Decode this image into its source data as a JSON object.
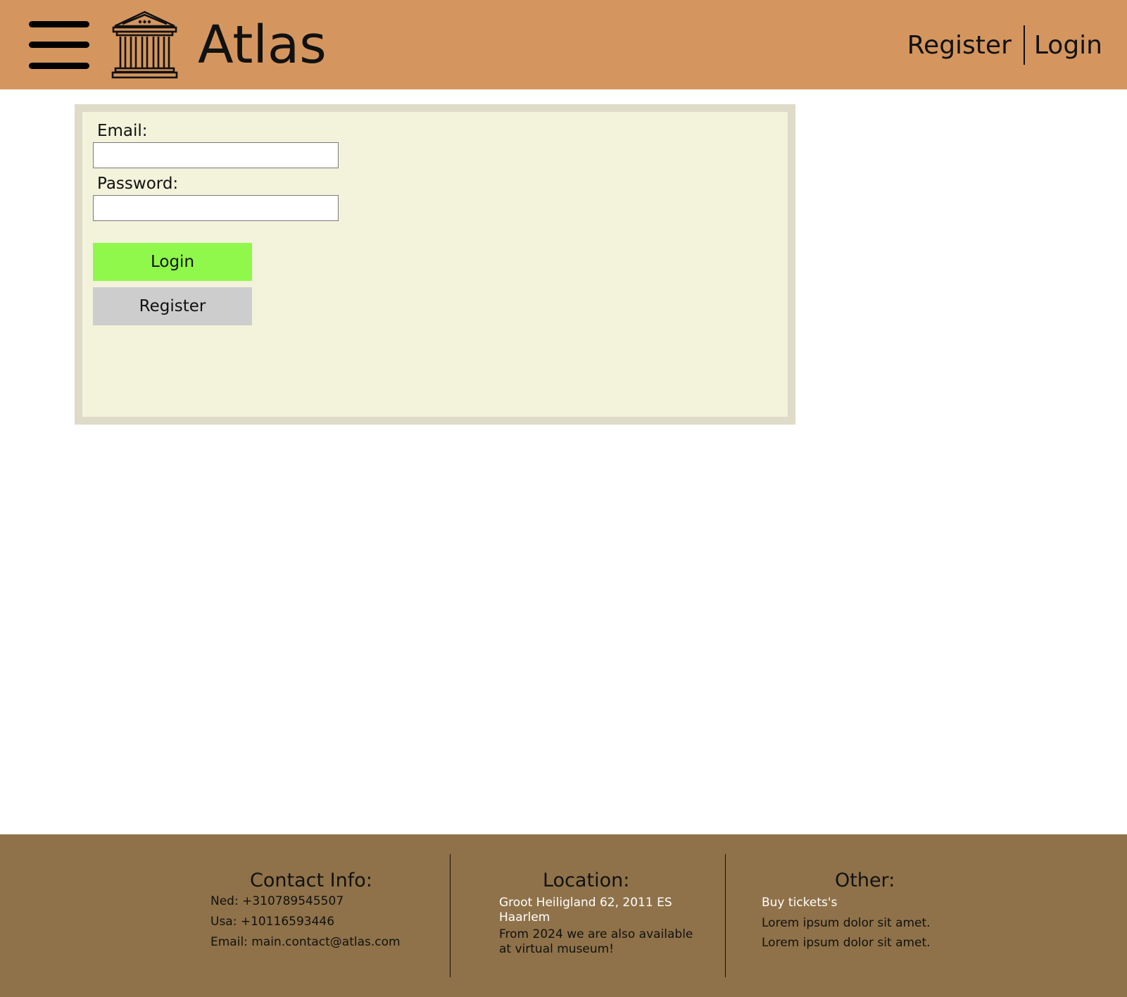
{
  "header": {
    "brand": "Atlas",
    "nav": {
      "register_label": "Register",
      "login_label": "Login"
    },
    "icons": [
      "menu-icon",
      "museum-icon"
    ]
  },
  "login_form": {
    "email_label": "Email:",
    "email_value": "",
    "password_label": "Password:",
    "password_value": "",
    "login_button": "Login",
    "register_button": "Register"
  },
  "footer": {
    "contact": {
      "heading": "Contact Info:",
      "lines": [
        "Ned: +310789545507",
        "Usa: +10116593446",
        "Email: main.contact@atlas.com"
      ]
    },
    "location": {
      "heading": "Location:",
      "address": "Groot Heiligland 62, 2011 ES Haarlem",
      "note": "From 2024 we are also available at virtual museum!"
    },
    "other": {
      "heading": "Other:",
      "links": [
        "Buy tickets's",
        "Lorem ipsum dolor sit amet.",
        "Lorem ipsum dolor sit amet."
      ]
    }
  },
  "colors": {
    "header_bg": "#d4965e",
    "footer_bg": "#8f7249",
    "panel_border": "#dedbc9",
    "panel_bg": "#f2f3da",
    "login_button": "#8ff84a",
    "register_button": "#cdcdcd"
  }
}
